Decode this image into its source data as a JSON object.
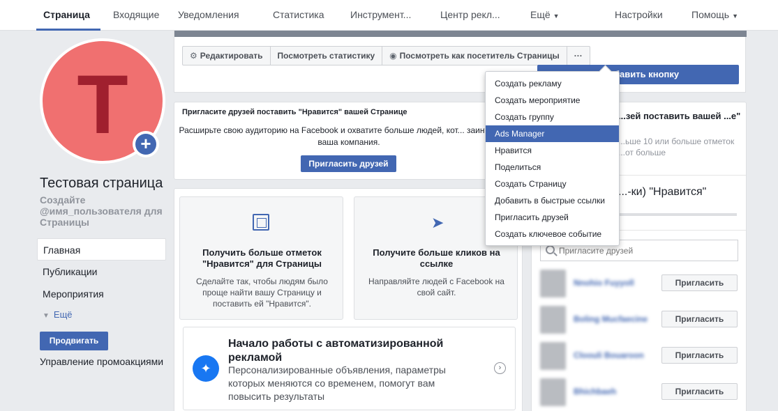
{
  "topnav": {
    "items": [
      "Страница",
      "Входящие",
      "Уведомления",
      "Статистика",
      "Инструмент...",
      "Центр рекл...",
      "Ещё",
      "Настройки",
      "Помощь"
    ],
    "active": "Страница"
  },
  "profile": {
    "avatar_letter": "T",
    "avatar_color": "#f07070",
    "name": "Тестовая страница",
    "username_prompt": "Создайте @имя_пользователя для Страницы"
  },
  "leftnav": {
    "items": [
      "Главная",
      "Публикации",
      "Мероприятия"
    ],
    "more": "Ещё",
    "promote_button": "Продвигать",
    "manage_promos": "Управление промоакциями"
  },
  "actionbar": {
    "edit": "Редактировать",
    "view_stats": "Посмотреть статистику",
    "view_as_visitor": "Посмотреть как посетитель Страницы",
    "more": "···",
    "add_button": "бавить кнопку"
  },
  "invite_card": {
    "title": "Пригласите друзей поставить \"Нравится\" вашей Странице",
    "description": "Расширьте свою аудиторию на Facebook и охватите больше людей, кот... заинтересует ваша компания.",
    "button": "Пригласить друзей"
  },
  "right_panel": {
    "hidden_title": "...зей поставить вашей ...е\"",
    "hidden_sub": "...ьше 10 или больше отметок ...от больше",
    "likes_title": "...-ки) \"Нравится\"",
    "search_placeholder": "Пригласите друзей",
    "friends": [
      {
        "name": "Nnohio Fuyyoll",
        "button": "Пригласить"
      },
      {
        "name": "Boling Mucfaecine",
        "button": "Пригласить"
      },
      {
        "name": "Cloouli Bouaroon",
        "button": "Пригласить"
      },
      {
        "name": "Bhichbaeh",
        "button": "Пригласить"
      }
    ]
  },
  "tiles": [
    {
      "icon": "page-like-icon",
      "title": "Получить больше отметок \"Нравится\" для Страницы",
      "description": "Сделайте так, чтобы людям было проще найти вашу Страницу и поставить ей \"Нравится\"."
    },
    {
      "icon": "cursor-icon",
      "title": "Получите больше кликов на ссылке",
      "description": "Направляйте людей с Facebook на свой сайт."
    }
  ],
  "auto_ads": {
    "title": "Начало работы с автоматизированной рекламой",
    "description": "Персонализированные объявления, параметры которых меняются со временем, помогут вам повысить результаты"
  },
  "dropdown": {
    "items": [
      "Создать рекламу",
      "Создать мероприятие",
      "Создать группу",
      "Ads Manager",
      "Нравится",
      "Поделиться",
      "Создать Страницу",
      "Добавить в быстрые ссылки",
      "Пригласить друзей",
      "Создать ключевое событие"
    ],
    "highlighted": "Ads Manager"
  },
  "colors": {
    "accent": "#4267b2",
    "background": "#e9ebee"
  }
}
